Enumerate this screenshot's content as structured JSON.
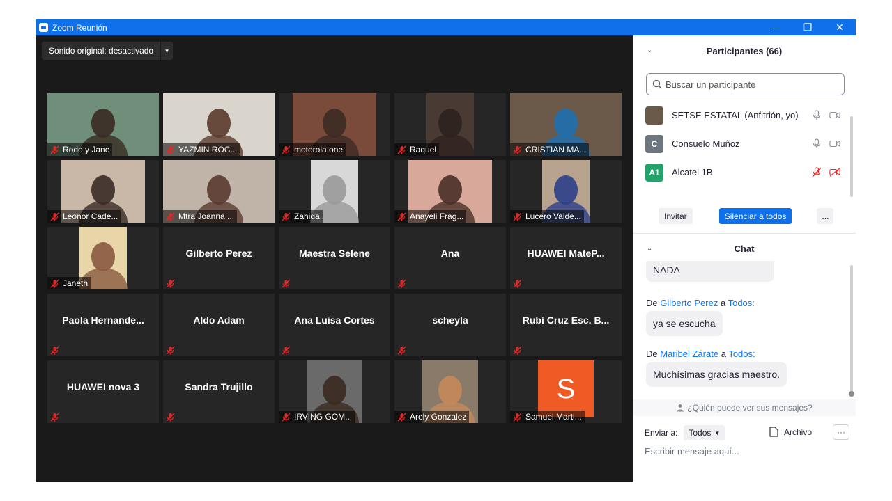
{
  "window": {
    "title": "Zoom Reunión"
  },
  "toolbar": {
    "sound_label": "Sonido original: desactivado"
  },
  "tiles": [
    {
      "name": "Rodo y Jane",
      "video": true,
      "bg": "#6f8f7a",
      "person": "#3a2a22"
    },
    {
      "name": "YAZMIN ROC...",
      "video": true,
      "bg": "#d9d4cc",
      "person": "#5b3b2e"
    },
    {
      "name": "motorola one",
      "video": true,
      "bg": "#7a4a3a",
      "person": "#3d2b25"
    },
    {
      "name": "Raquel",
      "video": true,
      "bg": "#4a3a34",
      "person": "#2e221e"
    },
    {
      "name": "CRISTIAN MA...",
      "video": true,
      "bg": "#6b5a4a",
      "person": "#1f6fb0"
    },
    {
      "name": "Leonor Cade...",
      "video": true,
      "bg": "#c9b8a8",
      "person": "#3a2b25"
    },
    {
      "name": "Mtra Joanna ...",
      "video": true,
      "bg": "#c0b3a8",
      "person": "#5a3a30"
    },
    {
      "name": "Zahida",
      "video": true,
      "bg": "#d8d8d8",
      "person": "#9a9a9a"
    },
    {
      "name": "Anayeli Frag...",
      "video": true,
      "bg": "#d8a89a",
      "person": "#4a3028"
    },
    {
      "name": "Lucero Valde...",
      "video": true,
      "bg": "#b8a48e",
      "person": "#2b3f8a"
    },
    {
      "name": "Janeth",
      "video": true,
      "bg": "#e8d6a8",
      "person": "#8a5a40"
    },
    {
      "name": "Gilberto Perez",
      "video": false
    },
    {
      "name": "Maestra Selene",
      "video": false
    },
    {
      "name": "Ana",
      "video": false
    },
    {
      "name": "HUAWEI  MateP...",
      "video": false
    },
    {
      "name": "Paola  Hernande...",
      "video": false
    },
    {
      "name": "Aldo Adam",
      "video": false
    },
    {
      "name": "Ana Luisa Cortes",
      "video": false
    },
    {
      "name": "scheyla",
      "video": false
    },
    {
      "name": "Rubí Cruz Esc. B...",
      "video": false
    },
    {
      "name": "HUAWEI nova 3",
      "video": false
    },
    {
      "name": "Sandra Trujillo",
      "video": false
    },
    {
      "name": "IRVING GOM...",
      "video": true,
      "bg": "#6a6a6a",
      "person": "#3a2a22"
    },
    {
      "name": "Arely Gonzalez",
      "video": true,
      "bg": "#8a7a6a",
      "person": "#c48a5a"
    },
    {
      "name": "Samuel Marti...",
      "video": true,
      "avatar_letter": "S",
      "bg": "#f05a24"
    }
  ],
  "participants": {
    "title": "Participantes (66)",
    "search_placeholder": "Buscar un participante",
    "list": [
      {
        "name": "SETSE ESTATAL (Anfitrión, yo)",
        "avatar": "",
        "avatar_color": "#6a5a4a",
        "muted": false
      },
      {
        "name": "Consuelo Muñoz",
        "avatar": "C",
        "avatar_color": "#6e7680",
        "muted": false
      },
      {
        "name": "Alcatel 1B",
        "avatar": "A1",
        "avatar_color": "#23a36a",
        "muted": true
      }
    ],
    "invite_label": "Invitar",
    "mute_all_label": "Silenciar a todos",
    "more_label": "..."
  },
  "chat": {
    "title": "Chat",
    "messages": [
      {
        "text": "NO ESCUCHO NADA DE NADA"
      },
      {
        "from_prefix": "De",
        "from": "Gilberto Perez",
        "to_prefix": "a",
        "to": "Todos:",
        "text": "ya se escucha"
      },
      {
        "from_prefix": "De",
        "from": "Maribel Zárate",
        "to_prefix": "a",
        "to": "Todos:",
        "text": "Muchísimas gracias maestro."
      }
    ],
    "who_can_see": "¿Quién puede ver sus mensajes?",
    "send_to_label": "Enviar a:",
    "send_to_value": "Todos",
    "file_label": "Archivo",
    "more_label": "···",
    "input_placeholder": "Escribir mensaje aquí..."
  }
}
